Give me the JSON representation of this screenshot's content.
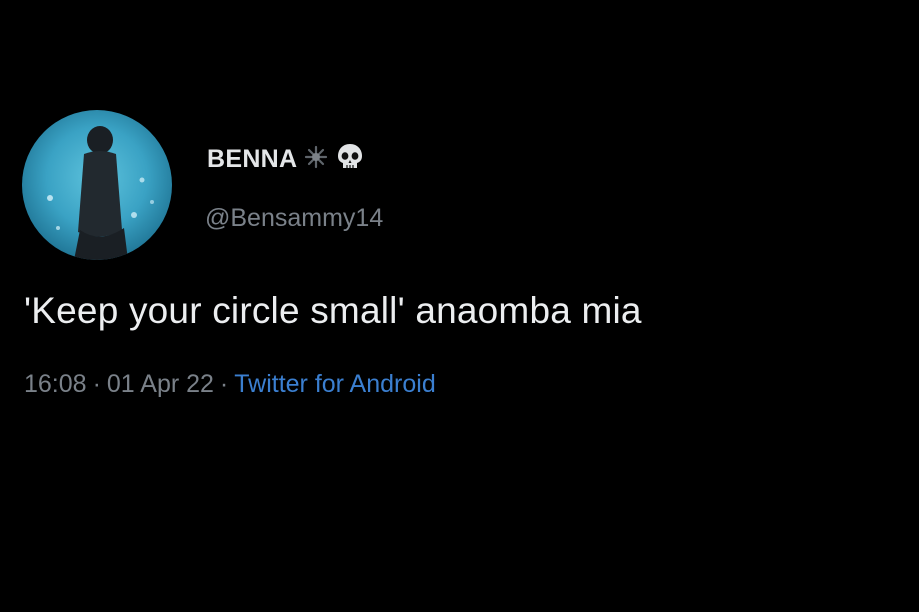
{
  "tweet": {
    "author": {
      "display_name": "BENNA",
      "name_emojis": [
        "sparkle-icon",
        "skull-icon"
      ],
      "handle": "@Bensammy14",
      "avatar": "avatar-person-silhouette"
    },
    "text": "'Keep your circle small' anaomba mia",
    "meta": {
      "time": "16:08",
      "separator": "·",
      "date": "01 Apr 22",
      "source": "Twitter for Android"
    }
  },
  "colors": {
    "background": "#000000",
    "text": "#eceef0",
    "secondary": "#7a8189",
    "link": "#3b7fd0"
  }
}
